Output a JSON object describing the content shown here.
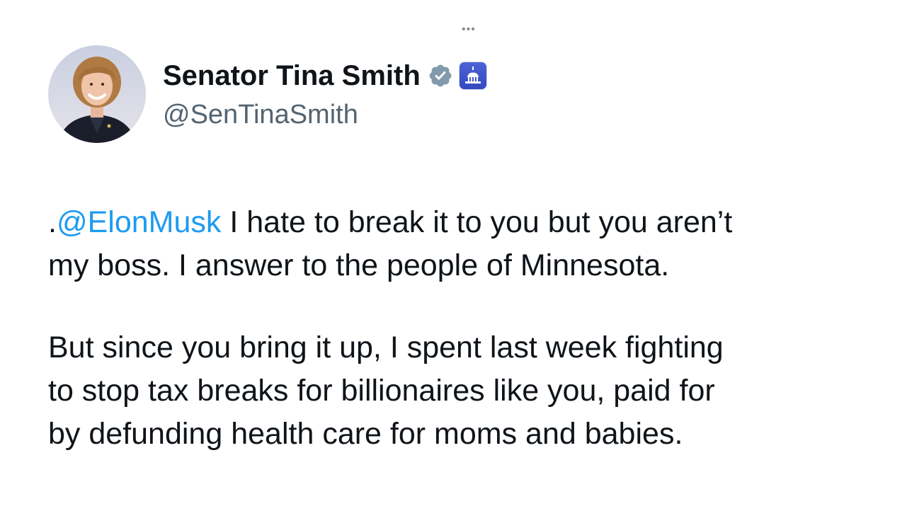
{
  "header": {
    "more_icon": "more-horizontal-icon",
    "display_name": "Senator Tina Smith",
    "handle": "@SenTinaSmith",
    "verified_icon": "verified-badge-icon",
    "affiliate_icon": "capitol-dome-icon",
    "verified_color": "#829aab",
    "affiliate_color": "#3d55c9"
  },
  "tweet": {
    "line1_prefix": ".",
    "mention": "@ElonMusk",
    "line1_rest": " I hate to break it to you but you aren’t",
    "line2": "my boss. I answer to the people of Minnesota.",
    "para2_line1": "But since you bring it up, I spent last week fighting",
    "para2_line2": "to stop tax breaks for billionaires like you, paid for",
    "para2_line3": "by defunding health care for moms and babies.",
    "mention_color": "#1d9bf0"
  }
}
